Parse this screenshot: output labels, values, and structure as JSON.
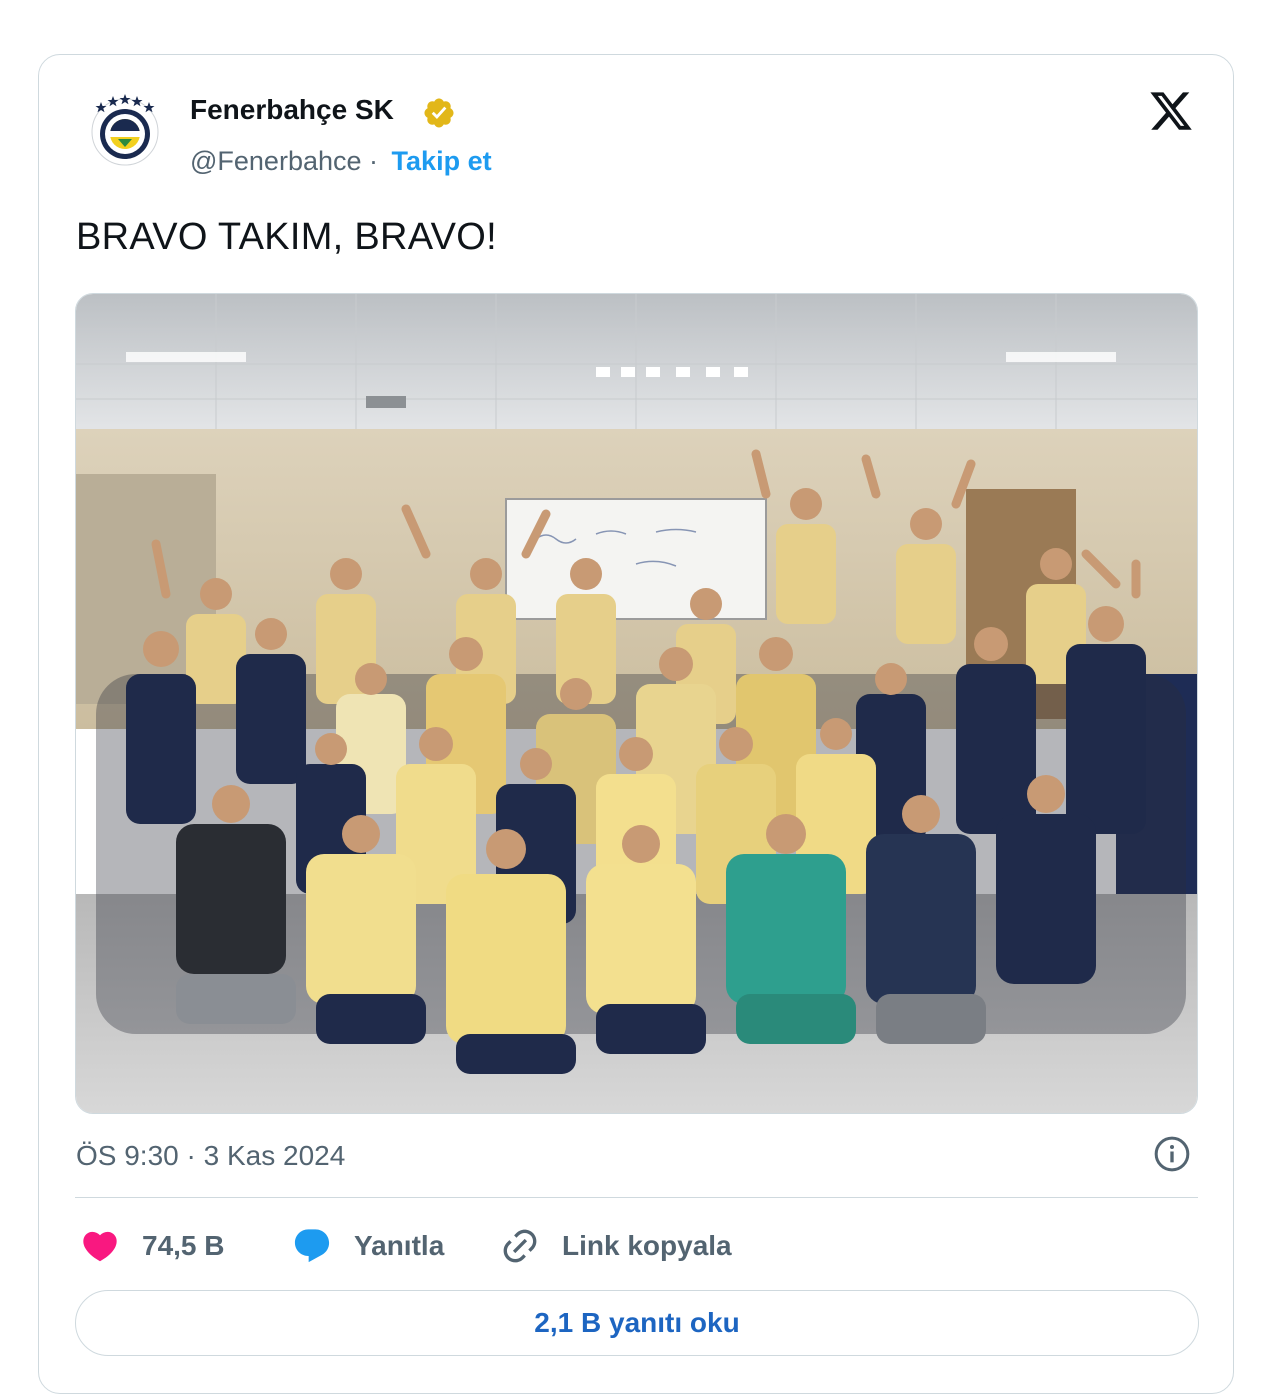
{
  "tweet": {
    "author_name": "Fenerbahçe SK",
    "handle": "@Fenerbahce",
    "separator": "·",
    "follow_label": "Takip et",
    "text": "BRAVO TAKIM, BRAVO!",
    "timestamp": "ÖS 9:30 · 3 Kas 2024"
  },
  "actions": {
    "likes": "74,5 B",
    "reply_label": "Yanıtla",
    "copy_link_label": "Link kopyala"
  },
  "read_replies_label": "2,1 B yanıtı oku",
  "icons": {
    "avatar": "fenerbahce-crest",
    "verified": "verified-gold-badge",
    "brand": "x-logo",
    "info": "info-icon",
    "like": "heart-icon",
    "reply": "speech-bubble-icon",
    "link": "link-icon"
  },
  "colors": {
    "like": "#f91880",
    "reply": "#1d9bf0",
    "follow": "#1d9bf0",
    "verified": "#e2b719",
    "read_replies": "#1d65c1",
    "secondary_text": "#536471"
  }
}
